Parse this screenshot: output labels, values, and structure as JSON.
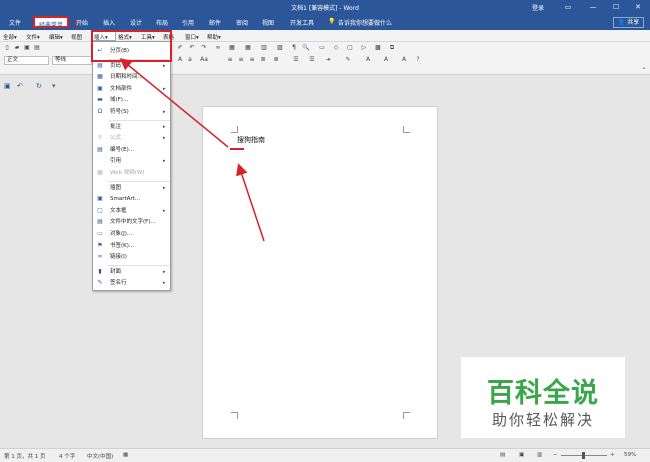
{
  "window": {
    "title": "文档1 [兼容模式] - Word",
    "login": "登录",
    "controls": {
      "ribbon_opts": "▭",
      "minimize": "—",
      "maximize": "☐",
      "close": "✕"
    }
  },
  "menu_tabs": {
    "file": "文件",
    "classic": "经典菜单",
    "home": "开始",
    "insert": "插入",
    "design": "设计",
    "layout": "布局",
    "references": "引用",
    "mailings": "邮件",
    "review": "审阅",
    "view": "视图",
    "developer": "开发工具",
    "tell_me": "告诉我你想要做什么",
    "share": "共享"
  },
  "classic_menus": {
    "all": "全部▾",
    "file": "文件▾",
    "edit": "编辑▾",
    "view": "视图",
    "insert": "插入▾",
    "format": "格式▾",
    "tools": "工具▾",
    "table": "表格",
    "window": "窗口▾",
    "help": "帮助▾"
  },
  "toolbar": {
    "style": "正文",
    "font": "等线"
  },
  "insert_menu": {
    "items": [
      {
        "label": "分页(B)",
        "arrow": false,
        "disabled": false,
        "icon": "↵"
      },
      {
        "label": "页码",
        "arrow": true,
        "disabled": false,
        "icon": "▤"
      },
      {
        "label": "日期和时间...",
        "arrow": false,
        "disabled": false,
        "icon": "▦"
      },
      {
        "label": "文档部件",
        "arrow": true,
        "disabled": false,
        "icon": "▣"
      },
      {
        "label": "域(F)...",
        "arrow": false,
        "disabled": false,
        "icon": "▬"
      },
      {
        "label": "符号(S)",
        "arrow": true,
        "disabled": false,
        "icon": "Ω"
      },
      {
        "label": "批注",
        "arrow": true,
        "disabled": false,
        "icon": ""
      },
      {
        "label": "公式",
        "arrow": true,
        "disabled": true,
        "icon": "π"
      },
      {
        "label": "编号(E)...",
        "arrow": false,
        "disabled": false,
        "icon": "▤"
      },
      {
        "label": "引用",
        "arrow": true,
        "disabled": false,
        "icon": ""
      },
      {
        "label": "Web 视频(W)",
        "arrow": false,
        "disabled": true,
        "icon": "▦"
      },
      {
        "label": "插图",
        "arrow": true,
        "disabled": false,
        "icon": ""
      },
      {
        "label": "SmartArt...",
        "arrow": false,
        "disabled": false,
        "icon": "▣"
      },
      {
        "label": "文本框",
        "arrow": true,
        "disabled": false,
        "icon": "▢"
      },
      {
        "label": "文件中的文字(F)...",
        "arrow": false,
        "disabled": false,
        "icon": "▤"
      },
      {
        "label": "对象(J)...",
        "arrow": false,
        "disabled": false,
        "icon": "▭"
      },
      {
        "label": "书签(K)...",
        "arrow": false,
        "disabled": false,
        "icon": "⚑"
      },
      {
        "label": "链接(I)",
        "arrow": false,
        "disabled": false,
        "icon": "∞"
      },
      {
        "label": "封面",
        "arrow": true,
        "disabled": false,
        "icon": "▮"
      },
      {
        "label": "签名行",
        "arrow": true,
        "disabled": false,
        "icon": "✎"
      }
    ]
  },
  "document": {
    "text": "搜狗指南"
  },
  "watermark": {
    "title": "百科全说",
    "subtitle": "助你轻松解决"
  },
  "status": {
    "pages": "第 1 页，共 1 页",
    "words": "4 个字",
    "language": "中文(中国)",
    "zoom": "59%"
  },
  "colors": {
    "brand": "#2b579a",
    "highlight": "#d4232a",
    "watermark_green": "#3aa64a"
  }
}
